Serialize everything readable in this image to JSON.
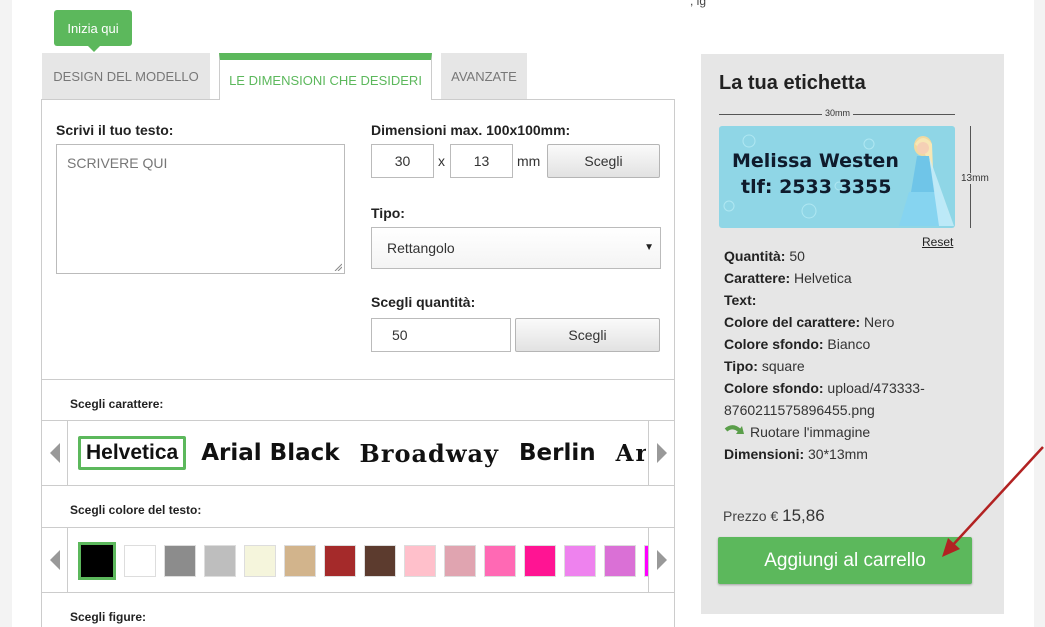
{
  "header": {
    "stub_text": ", ig",
    "start_button": "Inizia qui"
  },
  "tabs": [
    {
      "label": "DESIGN DEL MODELLO"
    },
    {
      "label": "LE DIMENSIONI CHE DESIDERI"
    },
    {
      "label": "AVANZATE"
    }
  ],
  "text_section": {
    "label": "Scrivi il tuo testo:",
    "placeholder": "SCRIVERE QUI"
  },
  "dimensions": {
    "label": "Dimensioni max. 100x100mm:",
    "width": "30",
    "x_sep": "x",
    "height": "13",
    "unit": "mm",
    "button": "Scegli"
  },
  "type": {
    "label": "Tipo:",
    "selected": "Rettangolo",
    "caret": "▼"
  },
  "quantity": {
    "label": "Scegli quantità:",
    "value": "50",
    "button": "Scegli"
  },
  "font_section": {
    "label": "Scegli carattere:",
    "fonts": [
      "Helvetica",
      "Arial Black",
      "Broadway",
      "Berlin",
      "Arbu"
    ]
  },
  "color_section": {
    "label": "Scegli colore del testo:",
    "colors": [
      "#000000",
      "#ffffff",
      "#8c8c8c",
      "#bebebe",
      "#f5f5dc",
      "#d2b48c",
      "#a52a2a",
      "#5c3b2e",
      "#ffc0cb",
      "#e0a4b0",
      "#ff69b4",
      "#ff1493",
      "#ee82ee",
      "#da70d6",
      "#ff00ff"
    ]
  },
  "figures_section": {
    "label": "Scegli figure:"
  },
  "summary": {
    "title": "La tua etichetta",
    "width_dim": "30mm",
    "height_dim": "13mm",
    "preview_line1": "Melissa Westen",
    "preview_line2": "tlf: 2533 3355",
    "reset": "Reset",
    "rows": [
      {
        "key": "Quantità:",
        "value": " 50"
      },
      {
        "key": "Carattere:",
        "value": " Helvetica"
      },
      {
        "key": "Text:",
        "value": ""
      },
      {
        "key": "Colore del carattere:",
        "value": " Nero"
      },
      {
        "key": "Colore sfondo:",
        "value": " Bianco"
      },
      {
        "key": "Tipo:",
        "value": " square"
      },
      {
        "key": "Colore sfondo:",
        "value": " upload/473333-"
      },
      {
        "key": "",
        "value": "8760211575896455.png"
      },
      {
        "key": "",
        "value": "Ruotare l'immagine"
      },
      {
        "key": "Dimensioni:",
        "value": " 30*13mm"
      }
    ],
    "price_label": "Prezzo €",
    "price_value": "15,86",
    "cart_button": "Aggiungi al carrello"
  },
  "colors": {
    "accent": "#5cb85c",
    "sidebar_bg": "#e6e6e6",
    "label_bg": "#8fd6e6",
    "annotation_arrow": "#b22222"
  }
}
